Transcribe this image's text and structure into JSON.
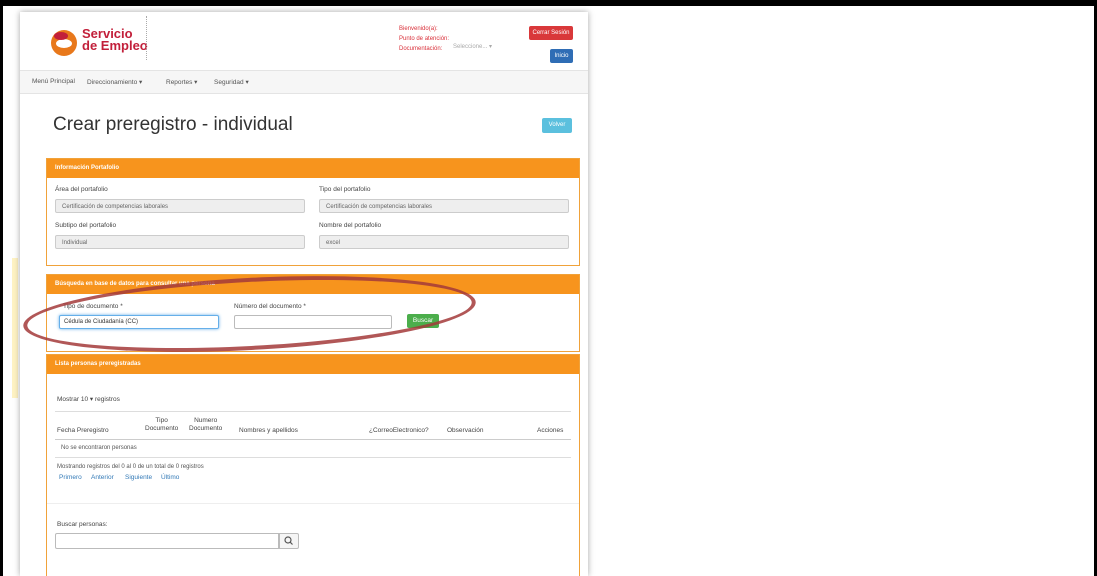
{
  "header": {
    "logo_line1": "Servicio",
    "logo_line2": "de Empleo",
    "welcome_label": "Bienvenido(a):",
    "attention_label": "Punto de atención:",
    "documentation_label": "Documentación:",
    "documentation_select": "Seleccione... ▾",
    "logout_button": "Cerrar Sesión",
    "home_button": "Inicio"
  },
  "nav": {
    "items": [
      "Menú Principal",
      "Direccionamiento ▾",
      "Reportes ▾",
      "Seguridad ▾"
    ]
  },
  "page": {
    "title": "Crear preregistro - individual",
    "back_button": "Volver"
  },
  "portfolio": {
    "header": "Información Portafolio",
    "area_label": "Área del portafolio",
    "area_value": "Certificación de competencias laborales",
    "type_label": "Tipo del portafolio",
    "type_value": "Certificación de competencias laborales",
    "subtype_label": "Subtipo del portafolio",
    "subtype_value": "Individual",
    "name_label": "Nombre del portafolio",
    "name_value": "excel"
  },
  "search_db": {
    "header": "Búsqueda en base de datos para consultar una persona",
    "doc_type_label": "Tipo de documento *",
    "doc_type_value": "Cédula de Ciudadanía (CC)",
    "doc_number_label": "Número del documento *",
    "doc_number_value": "",
    "search_button": "Buscar"
  },
  "list": {
    "header": "Lista personas preregistradas",
    "show_label": "Mostrar",
    "show_value": "10 ▾",
    "records_label": "registros",
    "columns": [
      "Fecha Preregistro",
      "Tipo\nDocumento",
      "Numero\nDocumento",
      "Nombres y apellidos",
      "¿CorreoElectronico?",
      "Observación",
      "Acciones"
    ],
    "empty_message": "No se encontraron personas",
    "summary": "Mostrando registros del 0 al 0 de un total de 0 registros",
    "pagination": [
      "Primero",
      "Anterior",
      "Siguiente",
      "Último"
    ],
    "search_label": "Buscar personas:",
    "search_value": ""
  },
  "colors": {
    "panel_orange": "#f7941d",
    "logout_red": "#d9383a",
    "home_blue": "#2f6db5",
    "back_cyan": "#5bc0de",
    "search_green": "#4cae4c",
    "annotation_oval": "#a33a3a"
  }
}
